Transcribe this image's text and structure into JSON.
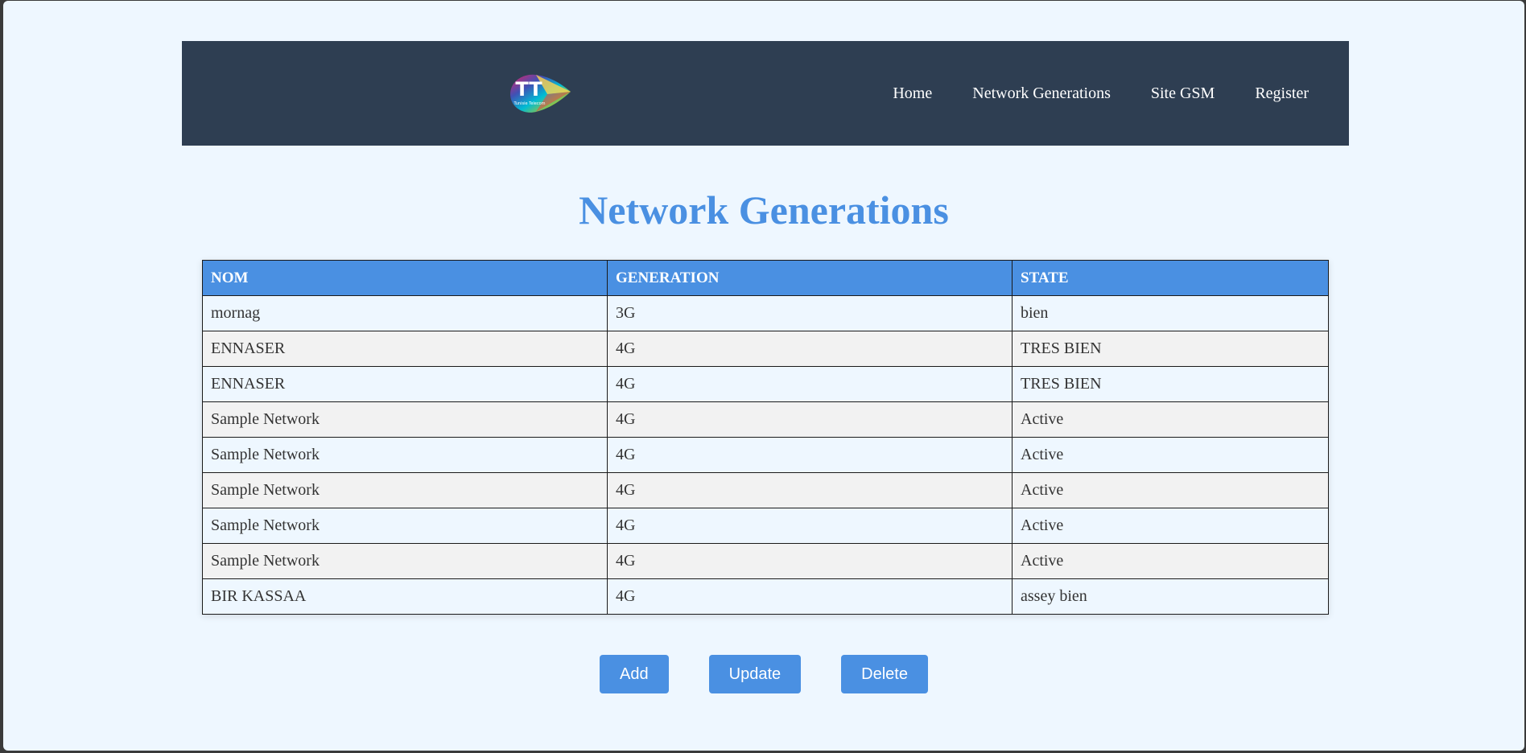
{
  "nav": {
    "logo_text": "TT",
    "logo_subtext": "Tunisie Telecom",
    "links": [
      "Home",
      "Network Generations",
      "Site GSM",
      "Register"
    ]
  },
  "page": {
    "title": "Network Generations"
  },
  "table": {
    "headers": [
      "NOM",
      "GENERATION",
      "STATE"
    ],
    "rows": [
      [
        "mornag",
        "3G",
        "bien"
      ],
      [
        "ENNASER",
        "4G",
        "TRES BIEN"
      ],
      [
        "ENNASER",
        "4G",
        "TRES BIEN"
      ],
      [
        "Sample Network",
        "4G",
        "Active"
      ],
      [
        "Sample Network",
        "4G",
        "Active"
      ],
      [
        "Sample Network",
        "4G",
        "Active"
      ],
      [
        "Sample Network",
        "4G",
        "Active"
      ],
      [
        "Sample Network",
        "4G",
        "Active"
      ],
      [
        "BIR KASSAA",
        "4G",
        "assey bien"
      ]
    ]
  },
  "actions": {
    "add_label": "Add",
    "update_label": "Update",
    "delete_label": "Delete"
  },
  "colors": {
    "navbar": "#2e3e52",
    "accent": "#4a90e2",
    "background": "#eef7ff"
  }
}
